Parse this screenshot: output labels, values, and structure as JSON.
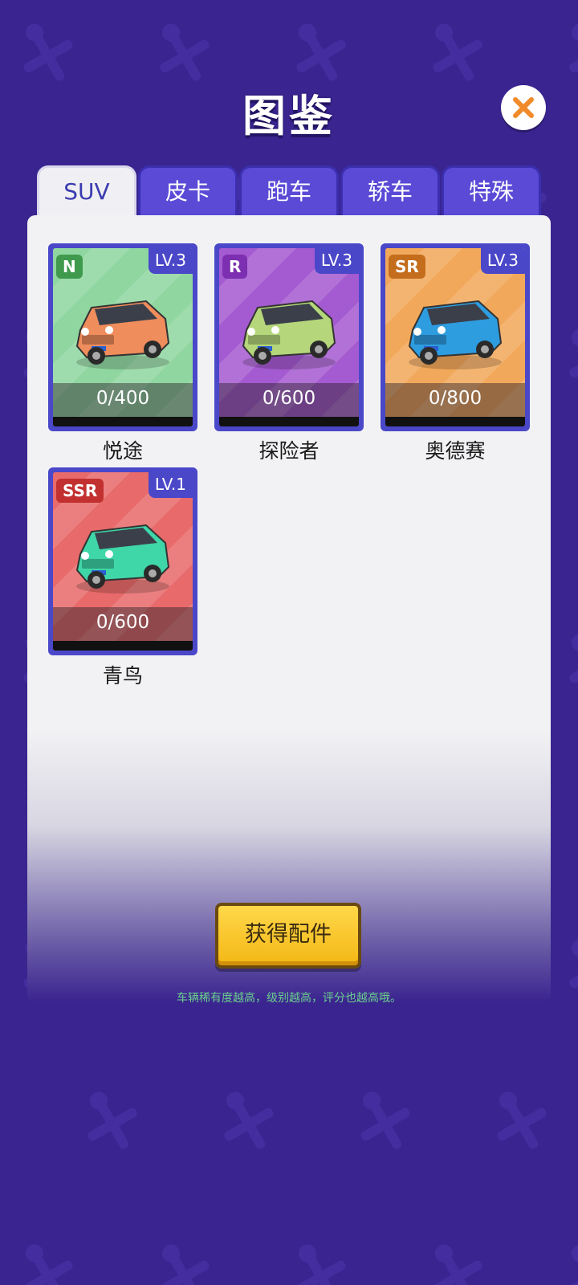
{
  "header": {
    "title": "图鉴"
  },
  "close_icon": "close-icon",
  "tabs": [
    {
      "label": "SUV",
      "active": true
    },
    {
      "label": "皮卡",
      "active": false
    },
    {
      "label": "跑车",
      "active": false
    },
    {
      "label": "轿车",
      "active": false
    },
    {
      "label": "特殊",
      "active": false
    }
  ],
  "cards": [
    {
      "name": "悦途",
      "rarity": "N",
      "level": "LV.3",
      "progress": "0/400",
      "progress_value": 0,
      "bg_color": "#8fd6a0",
      "rarity_color": "#3f9a4e",
      "car_color": "#f08d5c"
    },
    {
      "name": "探险者",
      "rarity": "R",
      "level": "LV.3",
      "progress": "0/600",
      "progress_value": 0,
      "bg_color": "#a45ad0",
      "rarity_color": "#7c2fb0",
      "car_color": "#b5d67a"
    },
    {
      "name": "奥德赛",
      "rarity": "SR",
      "level": "LV.3",
      "progress": "0/800",
      "progress_value": 0,
      "bg_color": "#f2a85a",
      "rarity_color": "#c46d1c",
      "car_color": "#2e9de0"
    },
    {
      "name": "青鸟",
      "rarity": "SSR",
      "level": "LV.1",
      "progress": "0/600",
      "progress_value": 0,
      "bg_color": "#e86a6a",
      "rarity_color": "#c23030",
      "car_color": "#3fd6a8"
    }
  ],
  "actions": {
    "get_parts": "获得配件"
  },
  "hint": "车辆稀有度越高，级别越高，评分也越高哦。"
}
